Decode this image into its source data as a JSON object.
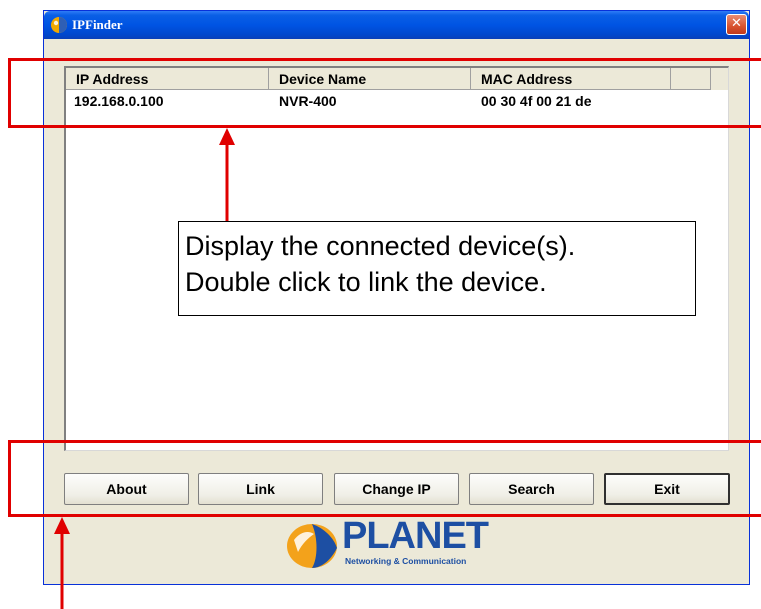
{
  "window": {
    "title": "IPFinder",
    "close_glyph": "✕"
  },
  "listview": {
    "columns": [
      "IP Address",
      "Device Name",
      "MAC Address",
      ""
    ],
    "rows": [
      {
        "ip": "192.168.0.100",
        "name": "NVR-400",
        "mac": "00 30 4f 00 21 de"
      }
    ]
  },
  "buttons": {
    "about": "About",
    "link": "Link",
    "change_ip": "Change IP",
    "search": "Search",
    "exit": "Exit"
  },
  "logo": {
    "word": "PLANET",
    "tagline": "Networking & Communication"
  },
  "annotation": {
    "line1": "Display the connected device(s).",
    "line2": "Double click to link the device."
  },
  "colors": {
    "annotation_red": "#e00000",
    "titlebar_blue": "#0054e3",
    "dialog_bg": "#ece9d8",
    "logo_blue": "#1d4fa3"
  }
}
